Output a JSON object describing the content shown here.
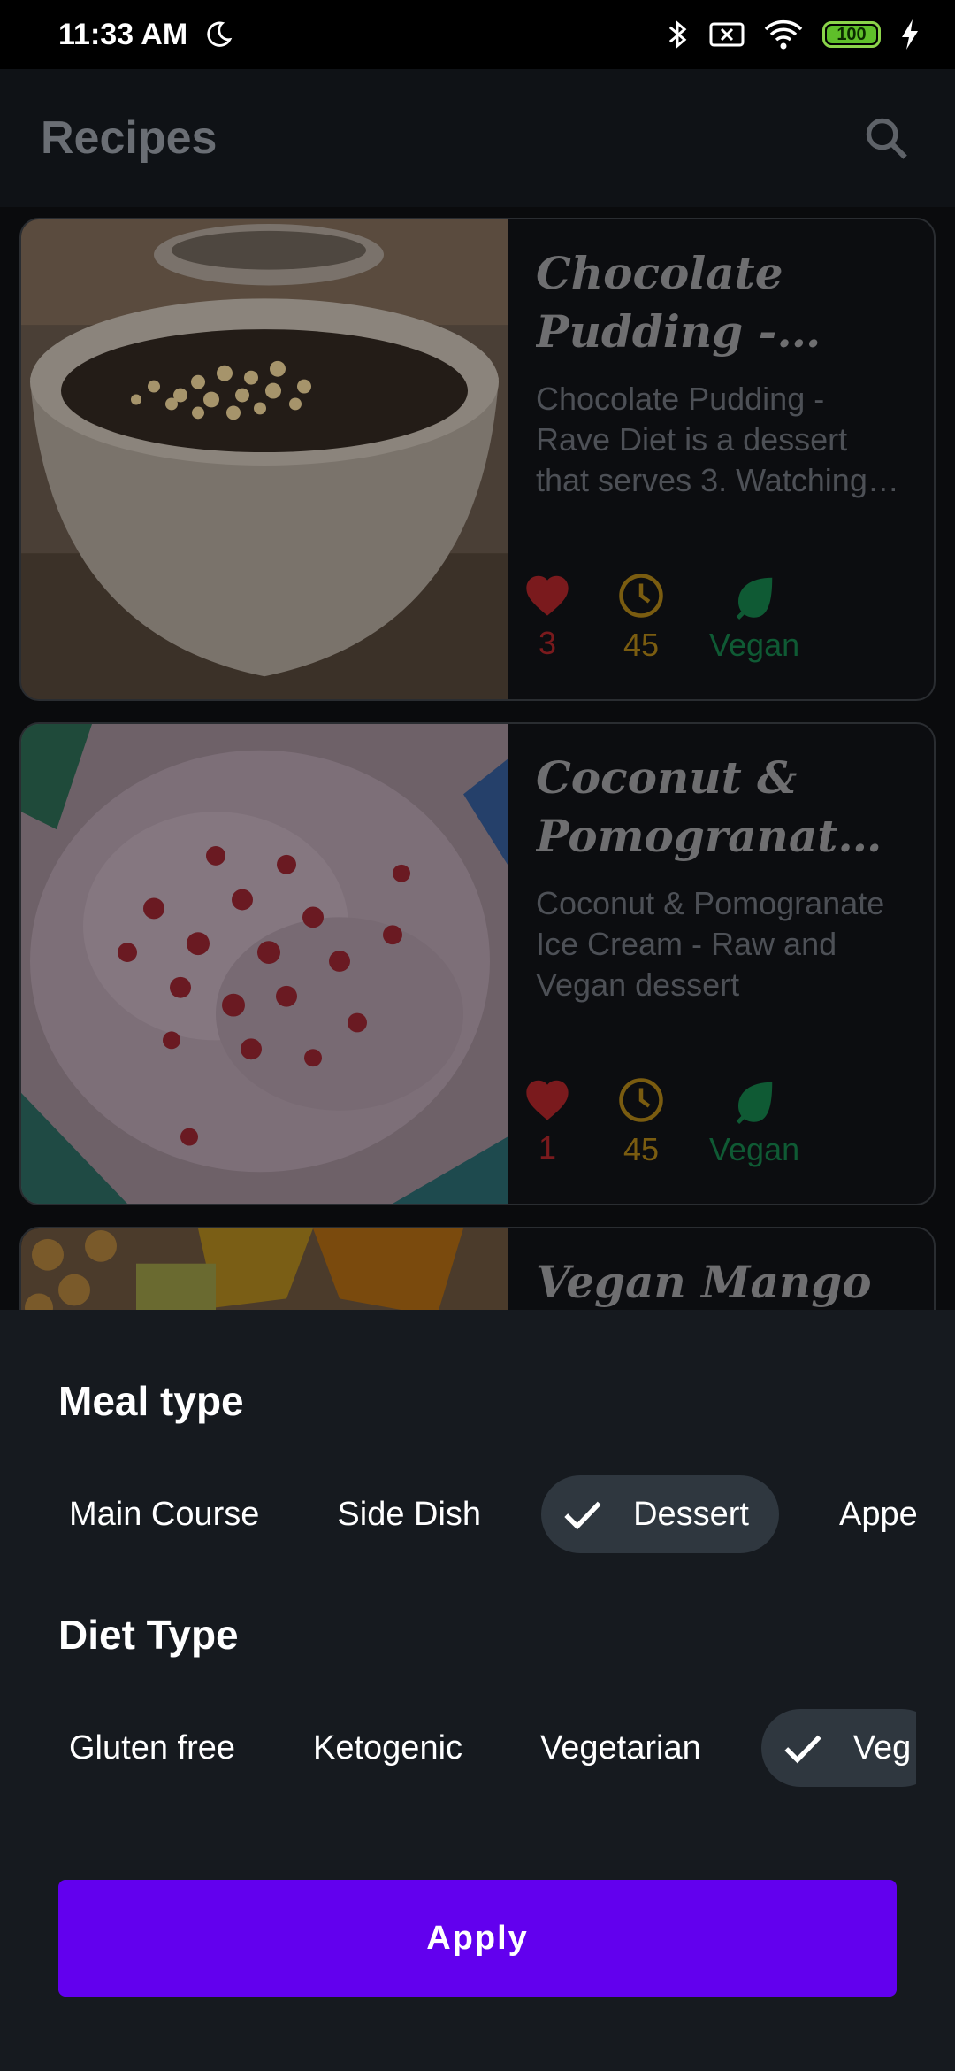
{
  "status_bar": {
    "time": "11:33 AM",
    "battery": "100"
  },
  "app_bar": {
    "title": "Recipes"
  },
  "recipes": [
    {
      "title": "Chocolate Pudding - Rave Diet",
      "description": "Chocolate Pudding - Rave Diet is a dessert that serves 3. Watching your figure?",
      "likes": "3",
      "minutes": "45",
      "diet_label": "Vegan"
    },
    {
      "title": "Coconut & Pomogranate Ice Cream",
      "description": "Coconut & Pomogranate Ice Cream - Raw and Vegan dessert",
      "likes": "1",
      "minutes": "45",
      "diet_label": "Vegan"
    },
    {
      "title": "Vegan Mango"
    }
  ],
  "sheet": {
    "meal_type_title": "Meal type",
    "meal_types": [
      "Main Course",
      "Side Dish",
      "Dessert",
      "Appet"
    ],
    "meal_selected": "Dessert",
    "diet_type_title": "Diet Type",
    "diet_types": [
      "Gluten free",
      "Ketogenic",
      "Vegetarian",
      "Veg"
    ],
    "diet_selected": "Veg",
    "apply_label": "Apply"
  },
  "colors": {
    "accent": "#6200ee",
    "like": "#7a1a1d",
    "time": "#7a5c10",
    "vegan": "#0f5a34",
    "chip_selected": "#2f373f"
  }
}
